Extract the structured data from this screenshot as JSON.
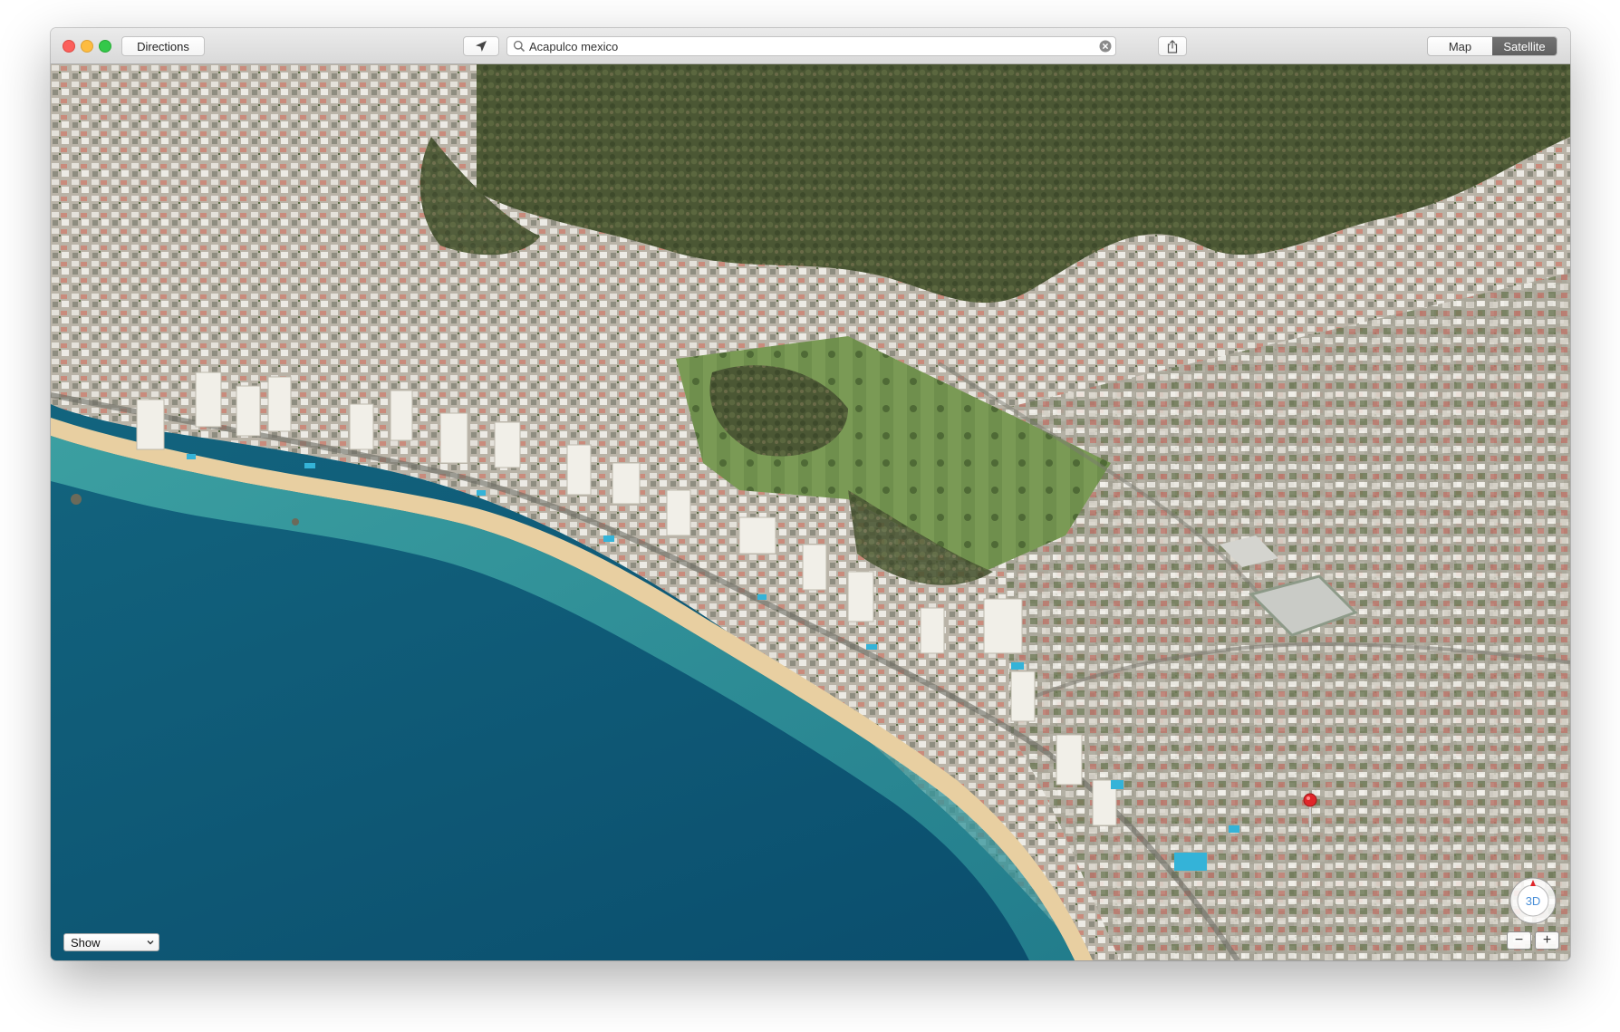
{
  "window": {
    "traffic_lights": [
      "close",
      "minimize",
      "zoom"
    ]
  },
  "toolbar": {
    "directions_label": "Directions",
    "locate_icon": "location-arrow-icon",
    "share_icon": "share-icon",
    "search": {
      "value": "Acapulco mexico",
      "icon": "search-icon",
      "clear_icon": "clear-icon"
    },
    "view_modes": [
      {
        "label": "Map",
        "active": false
      },
      {
        "label": "Satellite",
        "active": true
      }
    ]
  },
  "map": {
    "mode": "Satellite 3D flyover",
    "show_label": "Show",
    "compass_label": "3D",
    "zoom_out_label": "−",
    "zoom_in_label": "+",
    "pin_color": "#e0262a",
    "colors": {
      "ocean_deep": "#0e5877",
      "ocean_shallow": "#3aa7a6",
      "beach": "#ead2a6",
      "hills": "#4c5a35",
      "city": "#b7b1a6"
    }
  }
}
